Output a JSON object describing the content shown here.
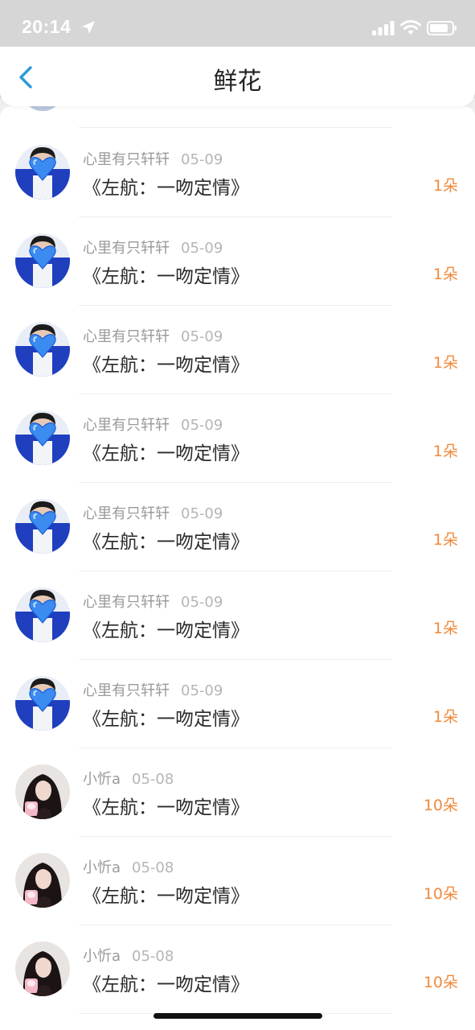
{
  "status_bar": {
    "time": "20:14",
    "icons": [
      "location-arrow-icon",
      "signal-icon",
      "wifi-icon",
      "battery-icon"
    ]
  },
  "nav": {
    "title": "鲜花",
    "back_icon": "chevron-left-icon"
  },
  "colors": {
    "accent": "#2b9bd8",
    "count": "#f08a3c",
    "meta": "#9a9a9a",
    "title": "#222222",
    "background": "#d6d6d6"
  },
  "items": [
    {
      "user": "心里有只轩轩",
      "date": "05-09",
      "title": "《左航：一吻定情》",
      "count": "1朵",
      "avatar": "boy-heart-avatar"
    },
    {
      "user": "心里有只轩轩",
      "date": "05-09",
      "title": "《左航：一吻定情》",
      "count": "1朵",
      "avatar": "boy-heart-avatar"
    },
    {
      "user": "心里有只轩轩",
      "date": "05-09",
      "title": "《左航：一吻定情》",
      "count": "1朵",
      "avatar": "boy-heart-avatar"
    },
    {
      "user": "心里有只轩轩",
      "date": "05-09",
      "title": "《左航：一吻定情》",
      "count": "1朵",
      "avatar": "boy-heart-avatar"
    },
    {
      "user": "心里有只轩轩",
      "date": "05-09",
      "title": "《左航：一吻定情》",
      "count": "1朵",
      "avatar": "boy-heart-avatar"
    },
    {
      "user": "心里有只轩轩",
      "date": "05-09",
      "title": "《左航：一吻定情》",
      "count": "1朵",
      "avatar": "boy-heart-avatar"
    },
    {
      "user": "心里有只轩轩",
      "date": "05-09",
      "title": "《左航：一吻定情》",
      "count": "1朵",
      "avatar": "boy-heart-avatar"
    },
    {
      "user": "小忻a",
      "date": "05-08",
      "title": "《左航：一吻定情》",
      "count": "10朵",
      "avatar": "girl-portrait-avatar"
    },
    {
      "user": "小忻a",
      "date": "05-08",
      "title": "《左航：一吻定情》",
      "count": "10朵",
      "avatar": "girl-portrait-avatar"
    },
    {
      "user": "小忻a",
      "date": "05-08",
      "title": "《左航：一吻定情》",
      "count": "10朵",
      "avatar": "girl-portrait-avatar"
    }
  ]
}
